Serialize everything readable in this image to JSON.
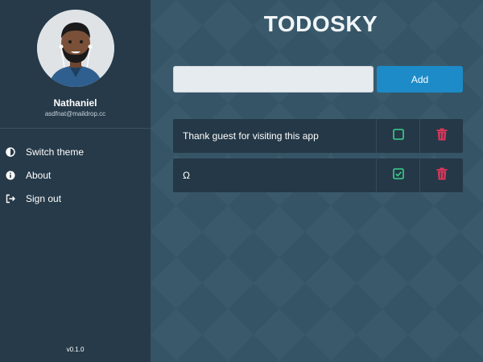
{
  "user": {
    "name": "Nathaniel",
    "email": "asdfnat@maildrop.cc"
  },
  "sidebar": {
    "items": [
      {
        "label": "Switch theme",
        "icon": "half-circle-icon"
      },
      {
        "label": "About",
        "icon": "info-icon"
      },
      {
        "label": "Sign out",
        "icon": "sign-out-icon"
      }
    ],
    "version": "v0.1.0"
  },
  "header": {
    "title": "TODOSKY"
  },
  "add_form": {
    "input_value": "",
    "button_label": "Add"
  },
  "todos": [
    {
      "text": "Thank guest for visiting this app",
      "done": false
    },
    {
      "text": "Ω",
      "done": true
    }
  ],
  "colors": {
    "sidebar_bg": "#263a49",
    "main_bg": "#355466",
    "accent": "#1d8bc8",
    "check": "#3ecf8e",
    "delete": "#e0365a"
  }
}
